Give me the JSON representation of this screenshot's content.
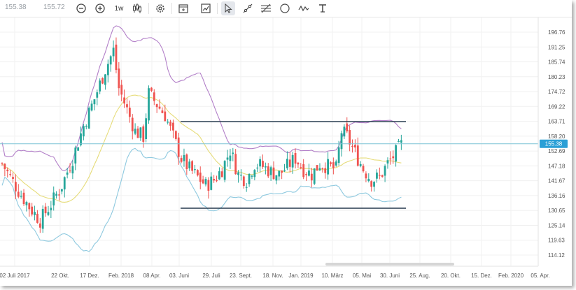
{
  "toolbar": {
    "price_a": "155.38",
    "price_b": "155.72",
    "interval_label": "1w",
    "icons": [
      "zoom-out-icon",
      "zoom-in-icon",
      "candlestick-icon",
      "gear-icon",
      "calendar-icon",
      "chart-image-icon",
      "cursor-icon",
      "line-tool-icon",
      "fibonacci-icon",
      "circle-icon",
      "wave-icon",
      "text-icon"
    ]
  },
  "chart_data": {
    "type": "candlestick",
    "instrument_price": "155.38",
    "y_ticks": [
      "196.76",
      "191.25",
      "185.74",
      "180.23",
      "174.72",
      "169.22",
      "163.71",
      "158.20",
      "152.69",
      "147.18",
      "141.67",
      "136.16",
      "130.65",
      "125.14",
      "119.63",
      "114.12"
    ],
    "x_ticks": [
      "02 Juli 2017",
      "22 Okt.",
      "17 Dez.",
      "Feb. 2018",
      "08 Apr.",
      "03. Juni",
      "29. Juli",
      "23. Sept.",
      "18. Nov.",
      "Jan. 2019",
      "10. März",
      "05. Mai",
      "30. Juni",
      "25. Aug.",
      "20. Okt.",
      "15. Dez.",
      "Feb. 2020",
      "05. Apr."
    ],
    "ylim": [
      113.0,
      198.5
    ],
    "channel": {
      "upper": 163.6,
      "lower": 131.5
    },
    "colors": {
      "up": "#26a69a",
      "down": "#ef5350",
      "upper_band": "#b27fc8",
      "lower_band": "#8ec9df",
      "mid_band": "#e6dc7a",
      "channel": "#2b3f52",
      "price_line": "#7cc4d6",
      "price_tag": "#2b9fd6"
    }
  }
}
